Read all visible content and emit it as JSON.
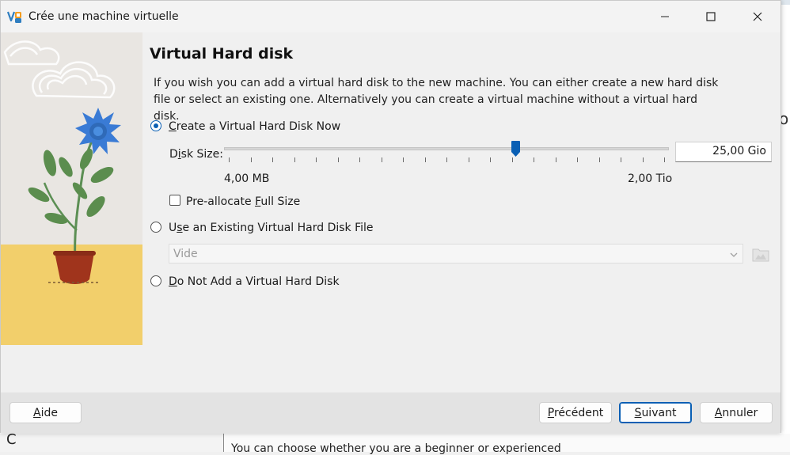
{
  "window": {
    "title": "Crée une machine virtuelle",
    "minimize_icon": "minimize-icon",
    "maximize_icon": "maximize-icon",
    "close_icon": "close-icon"
  },
  "page": {
    "heading": "Virtual Hard disk",
    "description": "If you wish you can add a virtual hard disk to the new machine. You can either create a new hard disk file or select an existing one. Alternatively you can create a virtual machine without a virtual hard disk."
  },
  "options": {
    "create_now": {
      "label": "Create a Virtual Hard Disk Now",
      "selected": true
    },
    "use_existing": {
      "label": "Use an Existing Virtual Hard Disk File",
      "selected": false
    },
    "do_not_add": {
      "label": "Do Not Add a Virtual Hard Disk",
      "selected": false
    }
  },
  "disk_size": {
    "label": "Disk Size:",
    "min_label": "4,00 MB",
    "max_label": "2,00 Tio",
    "value": "25,00 Gio",
    "slider_fraction": 0.655
  },
  "preallocate": {
    "label": "Pre-allocate Full Size",
    "checked": false
  },
  "existing_file": {
    "selected_value": "Vide"
  },
  "buttons": {
    "help": "Aide",
    "previous": "Précédent",
    "next": "Suivant",
    "cancel": "Annuler"
  },
  "background": {
    "bottom_text": "You can choose whether you are a beginner or experienced"
  },
  "colors": {
    "accent": "#0a5fb4",
    "dialog_bg": "#f0f0f0",
    "footer_bg": "#e3e3e3"
  }
}
